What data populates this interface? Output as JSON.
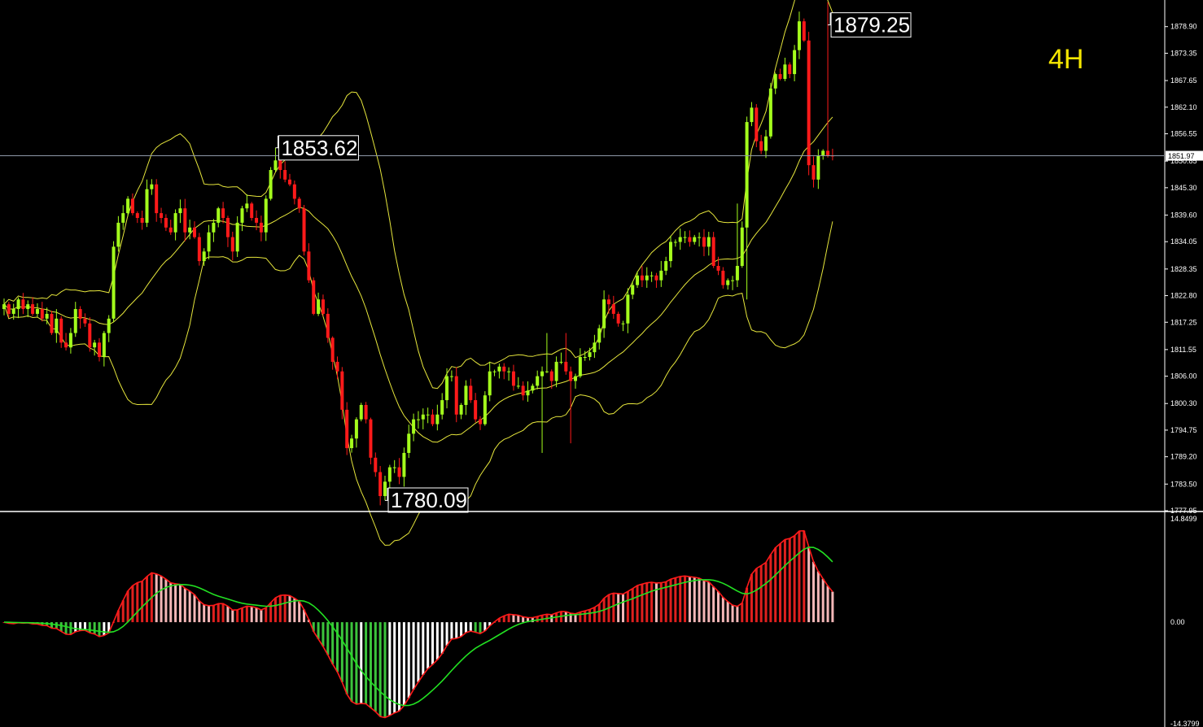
{
  "timeframe_label": "4H",
  "colors": {
    "background": "#000000",
    "up_candle": "#a4ff1c",
    "down_candle": "#ff1a1a",
    "bollinger": "#e6e63c",
    "macd_line": "#ff1a1a",
    "signal_line": "#22e022",
    "hist_pos_rising": "#e0201e",
    "hist_pos_falling": "#f4b7b7",
    "hist_neg_falling": "#3cc43c",
    "hist_neg_rising": "#ffffff",
    "axis": "#ffffff",
    "price_line": "#8f98a8"
  },
  "chart_data": [
    {
      "type": "candlestick",
      "ylim": [
        1777.95,
        1884.45
      ],
      "y_ticks": [
        "1878.90",
        "1873.35",
        "1867.65",
        "1862.10",
        "1856.55",
        "1850.85",
        "1845.30",
        "1839.60",
        "1834.05",
        "1828.35",
        "1822.80",
        "1817.25",
        "1811.55",
        "1806.00",
        "1800.30",
        "1794.75",
        "1789.20",
        "1783.50",
        "1777.95"
      ],
      "current_price": "1851.97",
      "annotations": [
        {
          "label": "1853.62",
          "value": 1853.62,
          "bar": 57
        },
        {
          "label": "1780.09",
          "value": 1780.09,
          "bar": 80
        },
        {
          "label": "1879.25",
          "value": 1879.25,
          "bar": 173
        }
      ],
      "closes": [
        1821,
        1819,
        1820,
        1822,
        1820,
        1821,
        1819,
        1820,
        1818,
        1819,
        1815,
        1818,
        1813,
        1812,
        1815,
        1820,
        1818,
        1817,
        1812,
        1813,
        1810,
        1815,
        1818,
        1833,
        1838,
        1840,
        1843,
        1840,
        1839,
        1838,
        1845,
        1846,
        1840,
        1839,
        1837,
        1836,
        1840,
        1841,
        1836,
        1837,
        1835,
        1830,
        1832,
        1836,
        1838,
        1841,
        1839,
        1835,
        1832,
        1838,
        1841,
        1842,
        1839,
        1838,
        1836,
        1843,
        1849,
        1851,
        1849,
        1847,
        1846,
        1843,
        1841,
        1832,
        1826,
        1819,
        1822,
        1819,
        1814,
        1809,
        1807,
        1799,
        1791,
        1793,
        1797,
        1800,
        1797,
        1789,
        1786,
        1781,
        1784,
        1787,
        1787,
        1785,
        1790,
        1794,
        1797,
        1797,
        1798,
        1798,
        1796,
        1798,
        1801,
        1806,
        1806,
        1798,
        1800,
        1804,
        1801,
        1797,
        1796,
        1802,
        1807,
        1807,
        1808,
        1807,
        1807,
        1804,
        1804,
        1802,
        1803,
        1804,
        1806,
        1807,
        1807,
        1805,
        1809,
        1809,
        1807,
        1805,
        1806,
        1810,
        1810,
        1811,
        1813,
        1816,
        1822,
        1821,
        1819,
        1817,
        1817,
        1823,
        1825,
        1827,
        1826,
        1827,
        1827,
        1826,
        1828,
        1830,
        1834,
        1834,
        1835,
        1835,
        1834,
        1835,
        1835,
        1833,
        1835,
        1829,
        1828,
        1825,
        1826,
        1826,
        1829,
        1837,
        1859,
        1862,
        1855,
        1853,
        1856,
        1866,
        1869,
        1868,
        1871,
        1869,
        1874,
        1880,
        1876,
        1850,
        1847,
        1852,
        1853,
        1852,
        1851.97
      ]
    },
    {
      "type": "bar",
      "ylim": [
        -14.3799,
        14.8499
      ],
      "y_ticks": [
        "14.8499",
        "0.00",
        "-14.3799"
      ],
      "series": []
    }
  ]
}
